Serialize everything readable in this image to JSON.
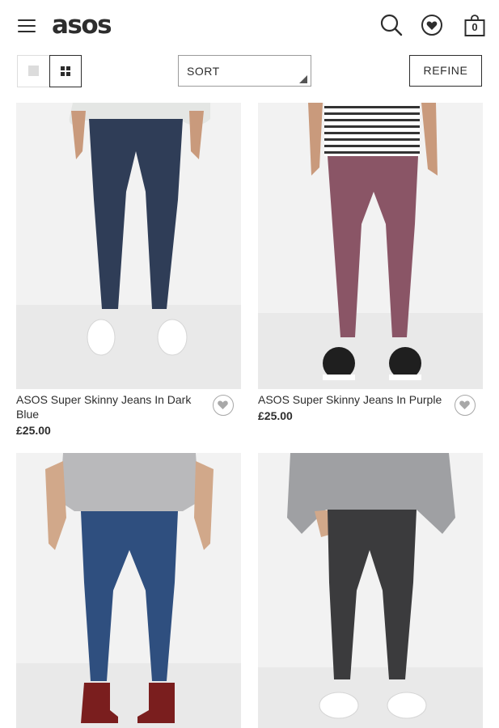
{
  "header": {
    "logo": "asos",
    "bag_count": "0",
    "icons": [
      "menu-icon",
      "search-icon",
      "heart-icon",
      "bag-icon"
    ]
  },
  "toolbar": {
    "sort_label": "SORT",
    "refine_label": "REFINE"
  },
  "products": [
    {
      "title": "ASOS Super Skinny Jeans In Dark Blue",
      "price": "£25.00",
      "color": "#2f3d57"
    },
    {
      "title": "ASOS Super Skinny Jeans In Purple",
      "price": "£25.00",
      "color": "#8a5566"
    },
    {
      "title": "",
      "price": "",
      "color": "#2f4f7f"
    },
    {
      "title": "",
      "price": "",
      "color": "#3b3b3d"
    }
  ],
  "colors": {
    "text": "#2d2d2d",
    "image_bg": "#ededed",
    "border": "#9b9b9b"
  }
}
